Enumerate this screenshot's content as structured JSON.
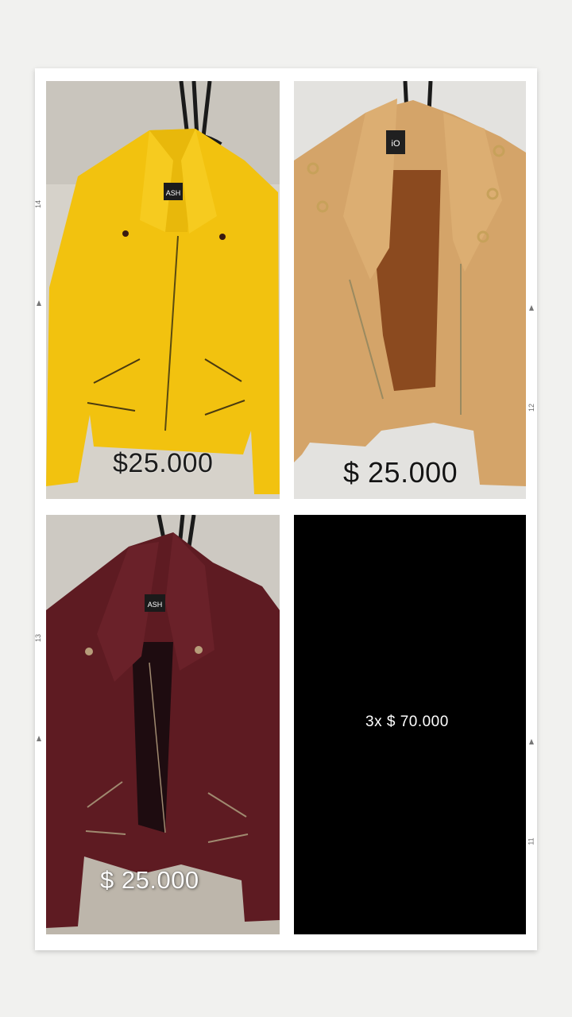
{
  "collage": {
    "items": [
      {
        "brand_tag": "ASH",
        "price": "$25.000",
        "color": "#f2c20f"
      },
      {
        "brand_tag": "iO",
        "price": "$ 25.000",
        "color": "#d4a469"
      },
      {
        "brand_tag": "ASH",
        "price": "$ 25.000",
        "color": "#5e1b22"
      }
    ],
    "offer_text": "3x $ 70.000"
  },
  "margin_marks": {
    "left_top": "14",
    "left_bottom": "13",
    "right_top": "12",
    "right_bottom": "11"
  }
}
